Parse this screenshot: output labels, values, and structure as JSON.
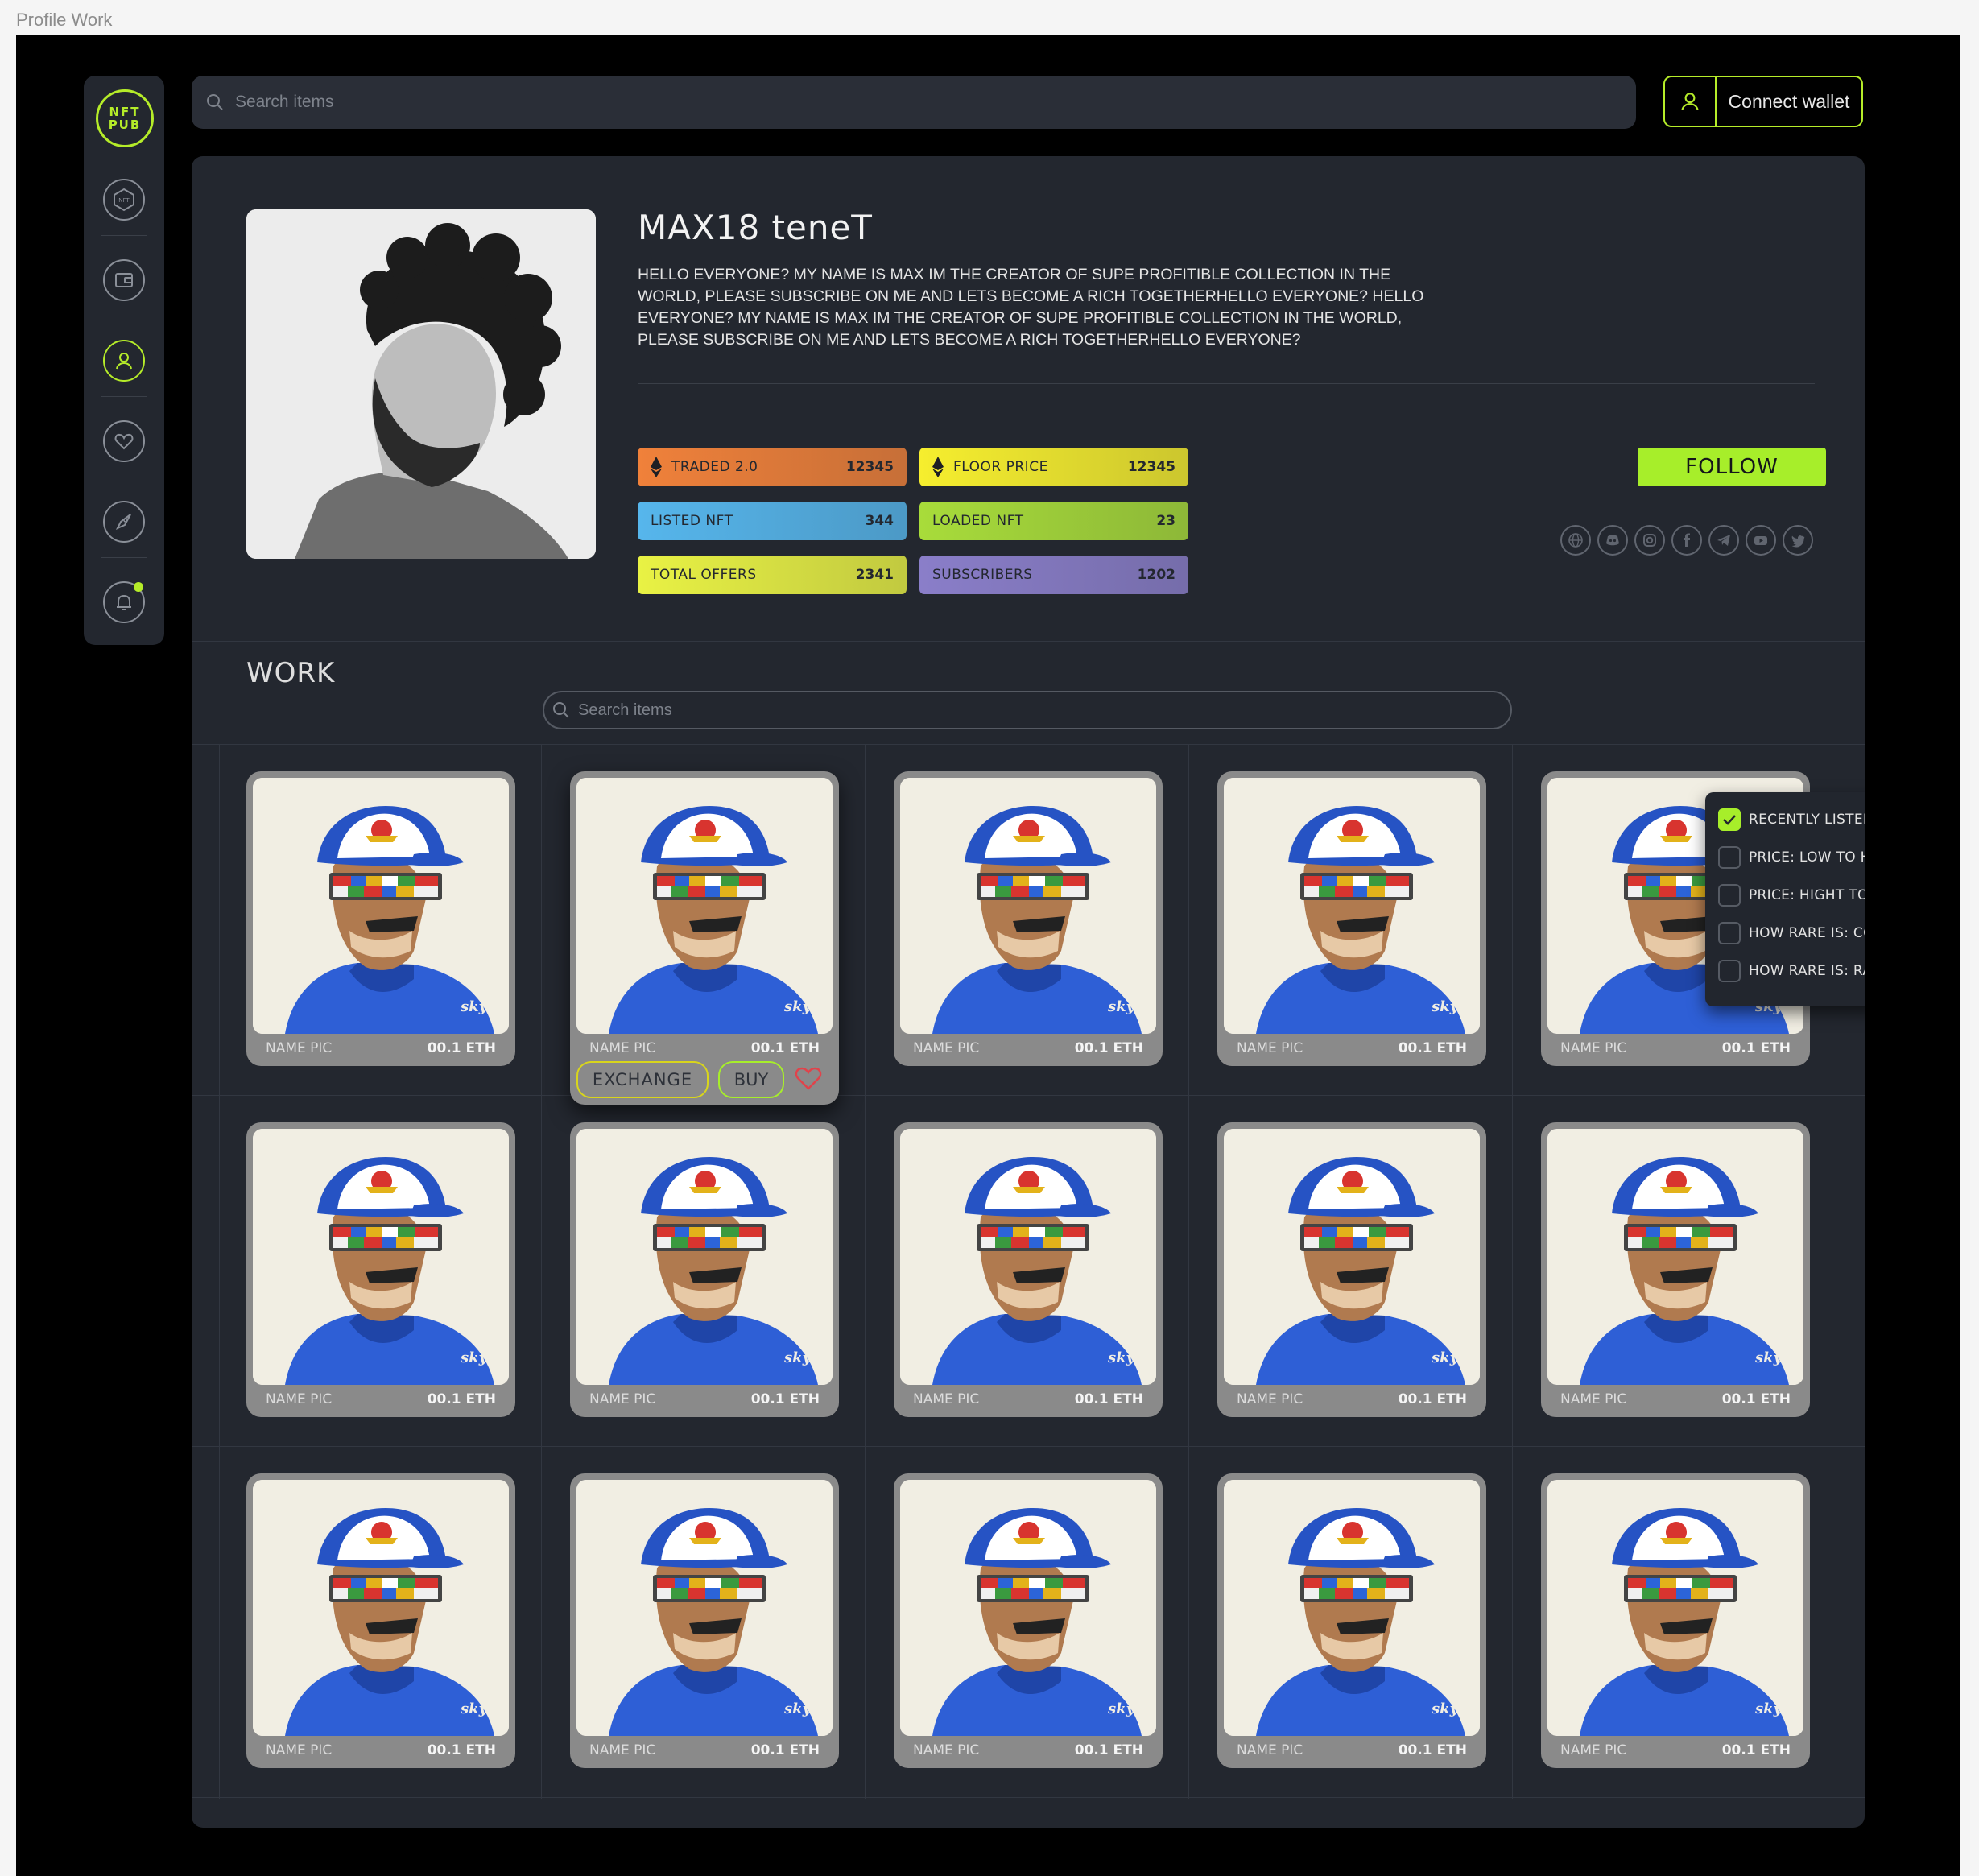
{
  "frame_label": "Profile Work",
  "logo": {
    "line1": "NFT",
    "line2": "PUB"
  },
  "sidebar": {
    "items": [
      {
        "icon": "nft-hex-icon",
        "active": false
      },
      {
        "icon": "wallet-icon",
        "active": false
      },
      {
        "icon": "user-icon",
        "active": true
      },
      {
        "icon": "heart-icon",
        "active": false
      },
      {
        "icon": "rocket-icon",
        "active": false
      },
      {
        "icon": "bell-icon",
        "active": false,
        "badge": true
      }
    ]
  },
  "search": {
    "placeholder": "Search items"
  },
  "wallet": {
    "label": "Connect wallet",
    "icon": "user-icon"
  },
  "profile": {
    "name": "MAX18 teneT",
    "bio": "HELLO EVERYONE? MY NAME IS MAX IM THE CREATOR  OF SUPE  PROFITIBLE COLLECTION IN THE WORLD, PLEASE SUBSCRIBE ON ME  AND LETS BECOME A RICH TOGETHERHELLO EVERYONE? HELLO EVERYONE? MY NAME IS MAX IM THE CREATOR  OF SUPE  PROFITIBLE COLLECTION IN THE WORLD, PLEASE SUBSCRIBE ON ME  AND LETS BECOME A RICH TOGETHERHELLO EVERYONE?",
    "follow_label": "FOLLOW",
    "stats": [
      {
        "label": "TRADED 2.0",
        "value": "12345",
        "eth_icon": true,
        "color": "#f0813a"
      },
      {
        "label": "FLOOR PRICE",
        "value": "12345",
        "eth_icon": true,
        "color": "#f6ee2e"
      },
      {
        "label": "LISTED NFT",
        "value": "344",
        "eth_icon": false,
        "color": "#56b6ec"
      },
      {
        "label": "LOADED NFT",
        "value": "23",
        "eth_icon": false,
        "color": "#a8dc3a"
      },
      {
        "label": "TOTAL OFFERS",
        "value": "2341",
        "eth_icon": false,
        "color": "#e9f244"
      },
      {
        "label": "SUBSCRIBERS",
        "value": "1202",
        "eth_icon": false,
        "color": "#8a7ec9"
      }
    ],
    "socials": [
      "globe-icon",
      "discord-icon",
      "instagram-icon",
      "facebook-icon",
      "telegram-icon",
      "youtube-icon",
      "twitter-icon"
    ]
  },
  "work": {
    "title": "WORK",
    "search_placeholder": "Search items",
    "sort": {
      "options": [
        {
          "label": "RECENTLY LISTED",
          "checked": true
        },
        {
          "label": "PRICE: LOW TO HIGHT",
          "checked": false
        },
        {
          "label": "PRICE: HIGHT TO LOW",
          "checked": false
        },
        {
          "label": "HOW RARE IS: COMMON TO RARE",
          "checked": false
        },
        {
          "label": "HOW RARE IS: RARE TO COMMON",
          "checked": false
        }
      ]
    },
    "card_actions": {
      "exchange_label": "EXCHANGE",
      "buy_label": "BUY"
    },
    "hovered_card_index": 1,
    "cards": [
      {
        "name": "NAME PIC",
        "price": "00.1 ETH"
      },
      {
        "name": "NAME PIC",
        "price": "00.1 ETH"
      },
      {
        "name": "NAME PIC",
        "price": "00.1 ETH"
      },
      {
        "name": "NAME PIC",
        "price": "00.1 ETH"
      },
      {
        "name": "NAME PIC",
        "price": "00.1 ETH"
      },
      {
        "name": "NAME PIC",
        "price": "00.1 ETH"
      },
      {
        "name": "NAME PIC",
        "price": "00.1 ETH"
      },
      {
        "name": "NAME PIC",
        "price": "00.1 ETH"
      },
      {
        "name": "NAME PIC",
        "price": "00.1 ETH"
      },
      {
        "name": "NAME PIC",
        "price": "00.1 ETH"
      },
      {
        "name": "NAME PIC",
        "price": "00.1 ETH"
      },
      {
        "name": "NAME PIC",
        "price": "00.1 ETH"
      },
      {
        "name": "NAME PIC",
        "price": "00.1 ETH"
      },
      {
        "name": "NAME PIC",
        "price": "00.1 ETH"
      },
      {
        "name": "NAME PIC",
        "price": "00.1 ETH"
      }
    ],
    "card_art_text": "sky"
  },
  "colors": {
    "accent": "#b5ec29",
    "bg": "#000000",
    "panel": "#23272f",
    "like": "#e0434b"
  }
}
